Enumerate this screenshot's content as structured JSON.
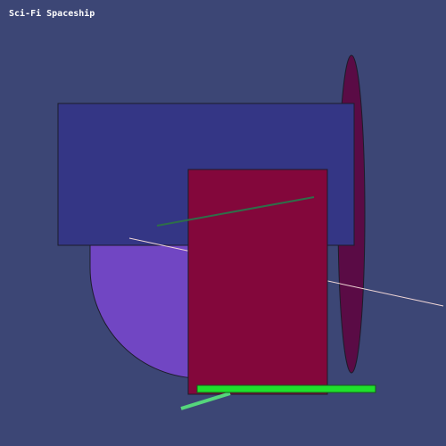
{
  "scene": {
    "title": "Sci-Fi Spaceship",
    "colors": {
      "background": "#3c4675",
      "hull_panel": "#343685",
      "dome": "#7146c3",
      "core_block": "#83073b",
      "wing_fin": "#5a0b45",
      "antenna": "#2e6e49",
      "laser_beam": "#f0d6d6",
      "thruster_bar": "#1fe02c",
      "exhaust_streak": "#55d67c"
    }
  }
}
